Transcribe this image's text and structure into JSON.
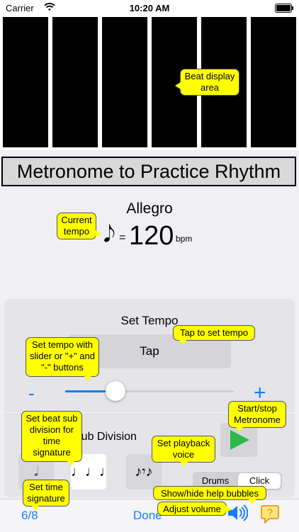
{
  "status_bar": {
    "carrier": "Carrier",
    "time": "10:20 AM",
    "icons": [
      "wifi-icon",
      "battery-icon"
    ]
  },
  "beat_display": {
    "bar_count": 6,
    "bar_color": "#000000"
  },
  "title": "Metronome to Practice Rhythm",
  "tempo": {
    "name": "Allegro",
    "note_symbol": "𝅘𝅥𝅮",
    "equals": "=",
    "value": "120",
    "unit": "bpm"
  },
  "set_tempo": {
    "label": "Set Tempo",
    "tap_label": "Tap",
    "minus_label": "-",
    "plus_label": "+",
    "slider_fraction": 0.3
  },
  "sub_division": {
    "label": "Sub Division",
    "options": [
      "𝅘𝅥",
      "♩♩♩",
      "♪𝄾♪"
    ],
    "selected_index": 1
  },
  "voice": {
    "options": [
      "Drums",
      "Click"
    ],
    "selected": "Click"
  },
  "toolbar": {
    "time_signature": "6/8",
    "done_label": "Done"
  },
  "help_bubbles": {
    "beat": "Beat display area",
    "current_tempo": "Current tempo",
    "tap": "Tap to set tempo",
    "slider": "Set tempo with slider or \"+\" and \"-\" buttons",
    "start_stop": "Start/stop Metronome",
    "sub_division": "Set beat sub division for time signature",
    "voice": "Set playback voice",
    "time_sig": "Set time signature",
    "show_hide": "Show/hide help bubbles",
    "volume": "Adjust volume"
  },
  "colors": {
    "accent": "#147efb",
    "bubble": "#ffff00",
    "play": "#2db84b"
  }
}
